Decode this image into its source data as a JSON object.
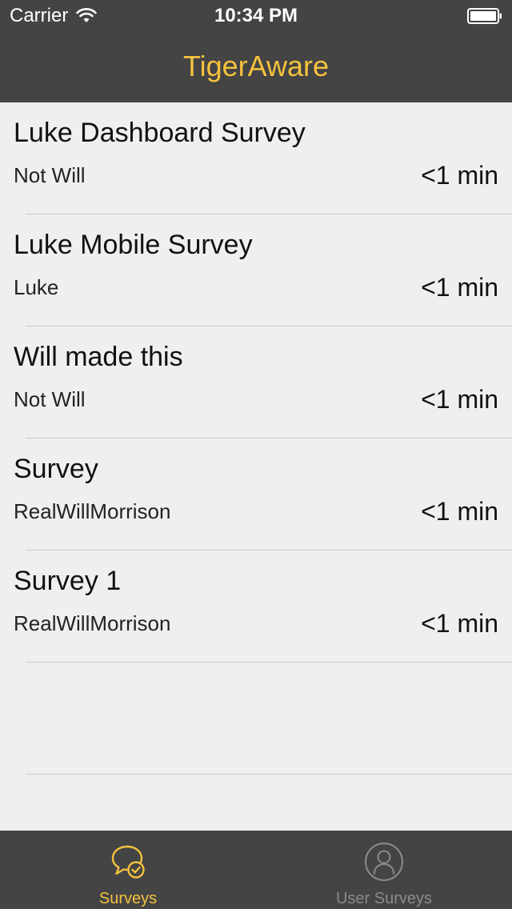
{
  "status_bar": {
    "carrier": "Carrier",
    "time": "10:34 PM",
    "icons": [
      "wifi-icon",
      "battery-icon"
    ]
  },
  "nav": {
    "title": "TigerAware"
  },
  "colors": {
    "accent": "#f5c23e",
    "header_bg": "#444444",
    "list_bg": "#efefef",
    "tab_inactive": "#8a8a8a"
  },
  "surveys": [
    {
      "title": "Luke Dashboard Survey",
      "author": "Not Will",
      "duration": "<1 min"
    },
    {
      "title": "Luke Mobile Survey",
      "author": "Luke",
      "duration": "<1 min"
    },
    {
      "title": "Will made this",
      "author": "Not Will",
      "duration": "<1 min"
    },
    {
      "title": "Survey",
      "author": "RealWillMorrison",
      "duration": "<1 min"
    },
    {
      "title": "Survey 1",
      "author": "RealWillMorrison",
      "duration": "<1 min"
    }
  ],
  "tabs": [
    {
      "label": "Surveys",
      "icon": "chat-check-icon",
      "active": true
    },
    {
      "label": "User Surveys",
      "icon": "user-circle-icon",
      "active": false
    }
  ]
}
